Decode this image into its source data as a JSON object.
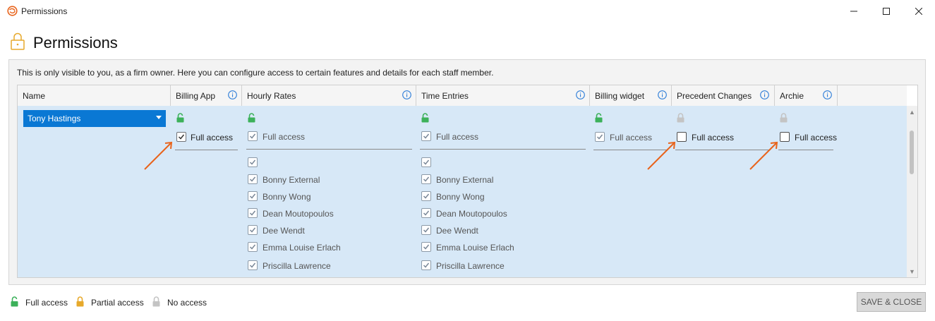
{
  "window": {
    "title": "Permissions",
    "minimize_label": "—",
    "maximize_label": "☐",
    "close_label": "✕"
  },
  "header": {
    "title": "Permissions"
  },
  "panel": {
    "info_text": "This is only visible to you, as a firm owner. Here you can configure access to certain features and details for each staff member."
  },
  "grid": {
    "columns": [
      {
        "key": "name",
        "label": "Name"
      },
      {
        "key": "billing_app",
        "label": "Billing App"
      },
      {
        "key": "hourly_rates",
        "label": "Hourly Rates"
      },
      {
        "key": "time_entries",
        "label": "Time Entries"
      },
      {
        "key": "billing_widget",
        "label": "Billing widget"
      },
      {
        "key": "precedent_changes",
        "label": "Precedent Changes"
      },
      {
        "key": "archie",
        "label": "Archie"
      }
    ],
    "row": {
      "staff": "Tony Hastings",
      "full_access_label": "Full access",
      "billing_app": {
        "lock": "full",
        "full_access": true
      },
      "hourly_rates": {
        "lock": "full",
        "full_access": true,
        "staff": [
          {
            "name": "",
            "checked": true
          },
          {
            "name": "Bonny External",
            "checked": true
          },
          {
            "name": "Bonny Wong",
            "checked": true
          },
          {
            "name": "Dean Moutopoulos",
            "checked": true
          },
          {
            "name": "Dee Wendt",
            "checked": true
          },
          {
            "name": "Emma Louise Erlach",
            "checked": true
          },
          {
            "name": "Priscilla Lawrence",
            "checked": true
          }
        ]
      },
      "time_entries": {
        "lock": "full",
        "full_access": true,
        "staff": [
          {
            "name": "",
            "checked": true
          },
          {
            "name": "Bonny External",
            "checked": true
          },
          {
            "name": "Bonny Wong",
            "checked": true
          },
          {
            "name": "Dean Moutopoulos",
            "checked": true
          },
          {
            "name": "Dee Wendt",
            "checked": true
          },
          {
            "name": "Emma Louise Erlach",
            "checked": true
          },
          {
            "name": "Priscilla Lawrence",
            "checked": true
          }
        ]
      },
      "billing_widget": {
        "lock": "full",
        "full_access": true
      },
      "precedent_changes": {
        "lock": "none",
        "full_access": false
      },
      "archie": {
        "lock": "none",
        "full_access": false
      }
    }
  },
  "legend": {
    "full": "Full access",
    "partial": "Partial access",
    "none": "No access"
  },
  "footer": {
    "save_close": "SAVE & CLOSE"
  },
  "colors": {
    "full": "#3cb15a",
    "partial": "#e7a92b",
    "none": "#c4c4c4",
    "accent": "#0a78d4",
    "row_bg": "#d7e8f7",
    "annotation": "#e8641c"
  }
}
